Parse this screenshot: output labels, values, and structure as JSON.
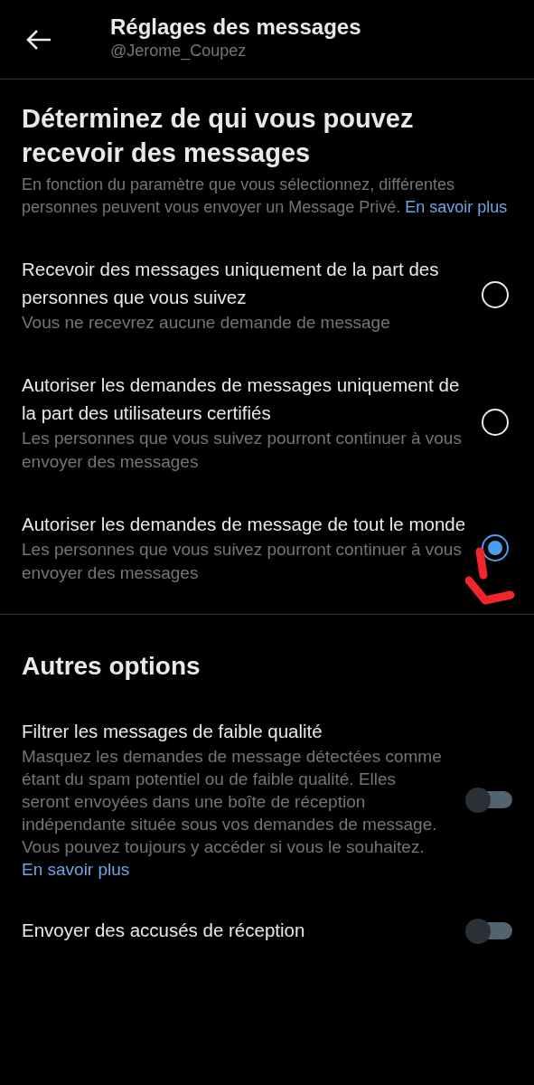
{
  "header": {
    "title": "Réglages des messages",
    "handle": "@Jerome_Coupez"
  },
  "intro": {
    "heading": "Déterminez de qui vous pouvez recevoir des messages",
    "description": "En fonction du paramètre que vous sélectionnez, différentes personnes peuvent vous envoyer un Message Privé.",
    "link": "En savoir plus"
  },
  "options": [
    {
      "title": "Recevoir des messages uniquement de la part des personnes que vous suivez",
      "subtitle": "Vous ne recevrez aucune demande de message",
      "selected": false
    },
    {
      "title": "Autoriser les demandes de messages uniquement de la part des utilisateurs certifiés",
      "subtitle": "Les personnes que vous suivez pourront continuer à vous envoyer des messages",
      "selected": false
    },
    {
      "title": "Autoriser les demandes de message de tout le monde",
      "subtitle": "Les personnes que vous suivez pourront continuer à vous envoyer des messages",
      "selected": true
    }
  ],
  "other_options": {
    "heading": "Autres options",
    "settings": [
      {
        "title": "Filtrer les messages de faible qualité",
        "description": "Masquez les demandes de message détectées comme étant du spam potentiel ou de faible qualité. Elles seront envoyées dans une boîte de réception indépendante située sous vos demandes de message. Vous pouvez toujours y accéder si vous le souhaitez.",
        "link": "En savoir plus",
        "on": false
      },
      {
        "title": "Envoyer des accusés de réception",
        "on": false
      }
    ]
  }
}
